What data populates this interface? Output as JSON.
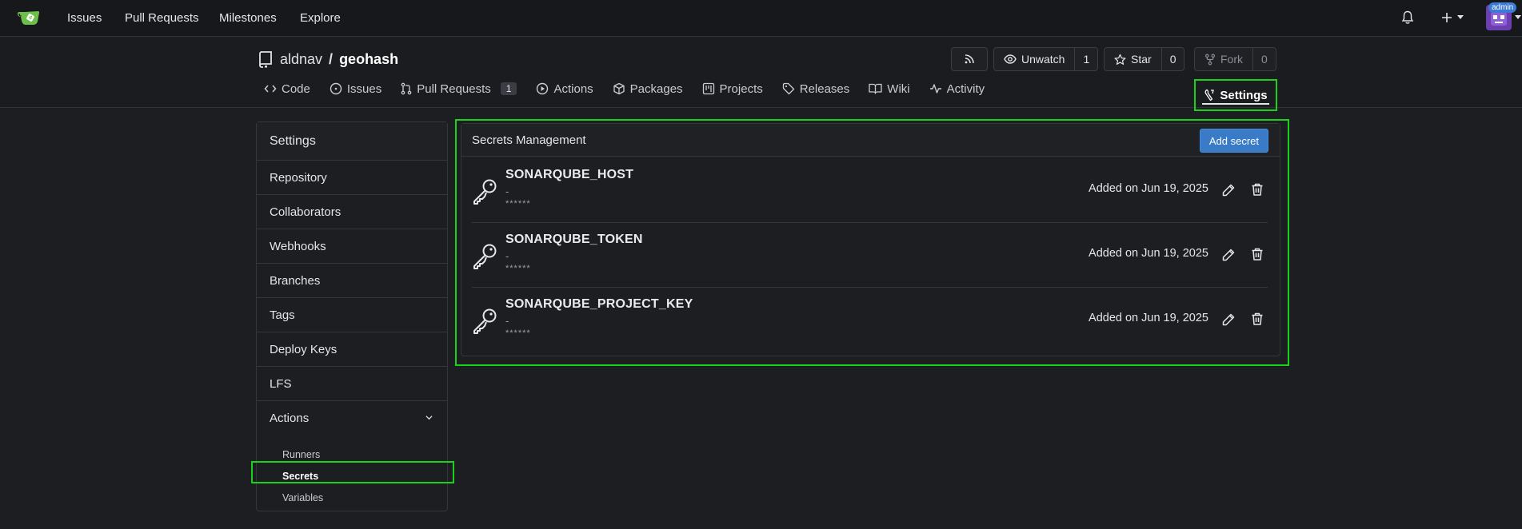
{
  "navbar": {
    "items": [
      "Issues",
      "Pull Requests",
      "Milestones",
      "Explore"
    ],
    "admin_badge": "admin",
    "icons": [
      "bell-icon",
      "plus-icon",
      "caret-down-icon"
    ]
  },
  "repo": {
    "owner": "aldnav",
    "separator": "/",
    "name": "geohash",
    "unwatch_label": "Unwatch",
    "watch_count": "1",
    "star_label": "Star",
    "star_count": "0",
    "fork_label": "Fork",
    "fork_count": "0"
  },
  "tabs": [
    {
      "label": "Code",
      "icon": "code-icon"
    },
    {
      "label": "Issues",
      "icon": "issue-icon"
    },
    {
      "label": "Pull Requests",
      "icon": "pull-request-icon",
      "badge": "1"
    },
    {
      "label": "Actions",
      "icon": "play-icon"
    },
    {
      "label": "Packages",
      "icon": "package-icon"
    },
    {
      "label": "Projects",
      "icon": "project-icon"
    },
    {
      "label": "Releases",
      "icon": "tag-icon"
    },
    {
      "label": "Wiki",
      "icon": "book-icon"
    },
    {
      "label": "Activity",
      "icon": "pulse-icon"
    }
  ],
  "settings_tab": {
    "label": "Settings"
  },
  "sidebar": {
    "title": "Settings",
    "items": [
      "Repository",
      "Collaborators",
      "Webhooks",
      "Branches",
      "Tags",
      "Deploy Keys",
      "LFS",
      "Actions"
    ],
    "sub_items": [
      "Runners",
      "Secrets",
      "Variables"
    ],
    "active_sub": "Secrets"
  },
  "panel": {
    "title": "Secrets Management",
    "add_button": "Add secret",
    "secrets": [
      {
        "name": "SONARQUBE_HOST",
        "description": "-",
        "mask": "******",
        "date": "Added on Jun 19, 2025"
      },
      {
        "name": "SONARQUBE_TOKEN",
        "description": "-",
        "mask": "******",
        "date": "Added on Jun 19, 2025"
      },
      {
        "name": "SONARQUBE_PROJECT_KEY",
        "description": "-",
        "mask": "******",
        "date": "Added on Jun 19, 2025"
      }
    ]
  },
  "colors": {
    "highlight": "#19d219",
    "accent_button": "#3a7bc8",
    "background": "#1c1e21"
  }
}
